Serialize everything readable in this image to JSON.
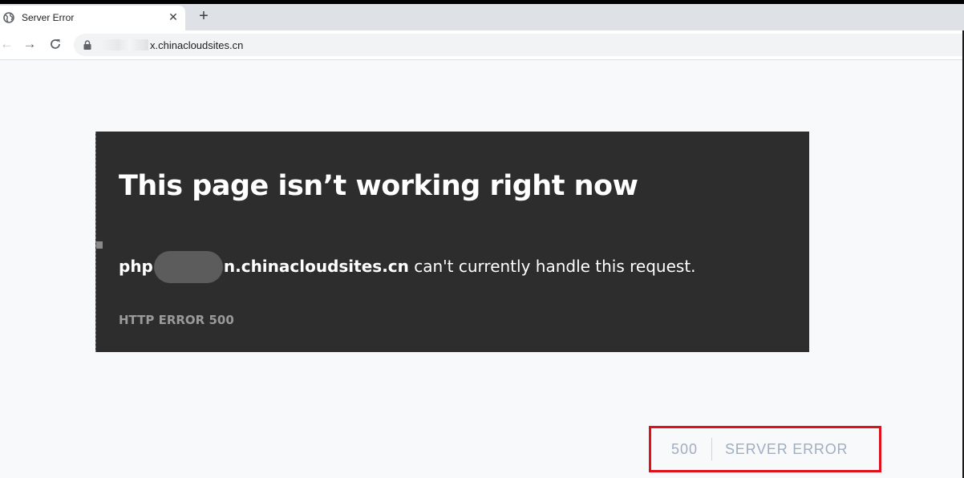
{
  "browser": {
    "tab": {
      "title": "Server Error",
      "close_glyph": "✕",
      "icon": "globe-icon"
    },
    "new_tab_glyph": "+",
    "toolbar": {
      "back_glyph": "←",
      "forward_glyph": "→",
      "reload_icon": "reload-icon",
      "lock_icon": "lock-icon"
    },
    "address_bar": {
      "url_visible": "x.chinacloudsites.cn"
    }
  },
  "error_card": {
    "heading": "This page isn’t working right now",
    "host_prefix": "php",
    "host_suffix": "n.chinacloudsites.cn",
    "message": " can't currently handle this request.",
    "error_code": "HTTP ERROR 500"
  },
  "status": {
    "code": "500",
    "text": "SERVER ERROR",
    "highlight_color": "#e0101c"
  }
}
